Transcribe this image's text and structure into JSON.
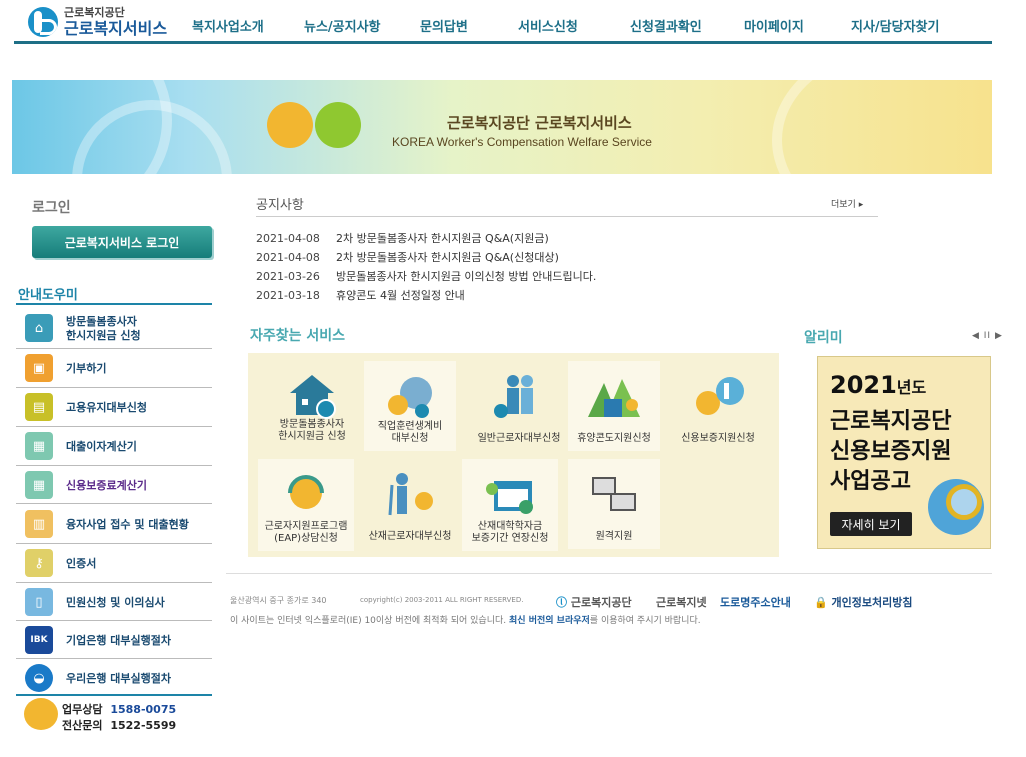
{
  "header": {
    "logo_small": "근로복지공단",
    "logo_big": "근로복지서비스",
    "nav": [
      "복지사업소개",
      "뉴스/공지사항",
      "문의답변",
      "서비스신청",
      "신청결과확인",
      "마이페이지",
      "지사/담당자찾기"
    ]
  },
  "banner": {
    "title": "근로복지공단 근로복지서비스",
    "subtitle": "KOREA Worker's Compensation Welfare Service"
  },
  "login": {
    "title": "로그인",
    "button": "근로복지서비스 로그인"
  },
  "guide": {
    "title": "안내도우미",
    "items": [
      {
        "label": "방문돌봄종사자\n한시지원금 신청",
        "icon": "house-icon",
        "color": "#3a9cb8"
      },
      {
        "label": "기부하기",
        "icon": "gift-box-icon",
        "color": "#f0a030"
      },
      {
        "label": "고용유지대부신청",
        "icon": "id-card-icon",
        "color": "#c8c028"
      },
      {
        "label": "대출이자계산기",
        "icon": "calculator-icon",
        "color": "#7ec8b0"
      },
      {
        "label": "신용보증료계산기",
        "icon": "calculator-icon",
        "color": "#7ec8b0"
      },
      {
        "label": "융자사업 접수 및 대출현황",
        "icon": "bar-chart-icon",
        "color": "#f0c060"
      },
      {
        "label": "인증서",
        "icon": "key-icon",
        "color": "#e0d068"
      },
      {
        "label": "민원신청 및 이의심사",
        "icon": "document-icon",
        "color": "#78b8e0"
      },
      {
        "label": "기업은행 대부실행절차",
        "icon": "ibk-logo-icon",
        "color": "#1a4a9a"
      },
      {
        "label": "우리은행 대부실행절차",
        "icon": "woori-logo-icon",
        "color": "#1a7ac8"
      }
    ],
    "contact": [
      {
        "label": "업무상담",
        "phone": "1588-0075"
      },
      {
        "label": "전산문의",
        "phone": "1522-5599"
      }
    ]
  },
  "notice": {
    "title": "공지사항",
    "more": "더보기",
    "items": [
      {
        "date": "2021-04-08",
        "title": "2차 방문돌봄종사자 한시지원금 Q&A(지원금)"
      },
      {
        "date": "2021-04-08",
        "title": "2차 방문돌봄종사자 한시지원금 Q&A(신청대상)"
      },
      {
        "date": "2021-03-26",
        "title": "방문돌봄종사자 한시지원금 이의신청 방법 안내드립니다."
      },
      {
        "date": "2021-03-18",
        "title": "휴양콘도 4월 선정일정 안내"
      }
    ]
  },
  "services": {
    "title": "자주찾는 서비스",
    "items": [
      {
        "label": "방문돌봄종사자\n한시지원금 신청",
        "icon": "house-coin-icon"
      },
      {
        "label": "직업훈련생계비\n대부신청",
        "icon": "head-gear-icon"
      },
      {
        "label": "일반근로자대부신청",
        "icon": "people-icon"
      },
      {
        "label": "휴양콘도지원신청",
        "icon": "condo-mountain-icon"
      },
      {
        "label": "신용보증지원신청",
        "icon": "credit-logo-icon"
      },
      {
        "label": "근로자지원프로그램\n(EAP)상담신청",
        "icon": "headset-mascot-icon"
      },
      {
        "label": "산재근로자대부신청",
        "icon": "crutch-worker-icon"
      },
      {
        "label": "산재대학학자금\n보증기간 연장신청",
        "icon": "calendar-icon"
      },
      {
        "label": "원격지원",
        "icon": "monitors-icon"
      }
    ]
  },
  "alimi": {
    "title": "알리미",
    "controls": "◀ II ▶",
    "year": "2021",
    "year_suffix": "년도",
    "lines": [
      "근로복지공단",
      "신용보증지원",
      "사업공고"
    ],
    "button": "자세히 보기"
  },
  "footer": {
    "address": "울산광역시 중구 종가로 340",
    "copyright": "copyright(c) 2003-2011 ALL RIGHT RESERVED.",
    "links": [
      "근로복지공단",
      "근로복지넷",
      "도로명주소안내",
      "개인정보처리방침"
    ],
    "notice_pre": "이 사이트는 인터넷 익스플로러(IE) 10이상 버전에 최적화 되어 있습니다.",
    "notice_link": "최신 버전의 브라우저",
    "notice_post": "를 이용하여 주시기 바랍니다."
  },
  "colors": {
    "brand": "#1d6f88",
    "accent": "#48a8b0",
    "login_button": "#167d7a"
  }
}
